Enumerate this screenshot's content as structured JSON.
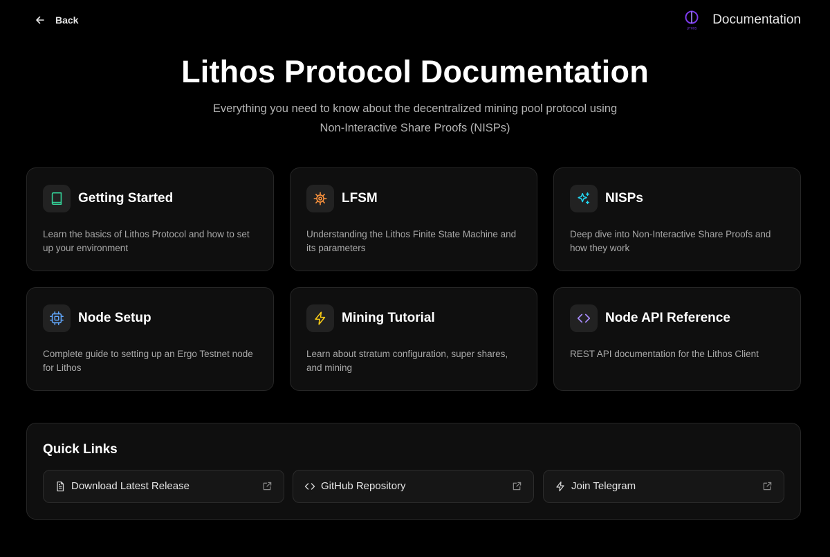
{
  "nav": {
    "back_label": "Back",
    "brand_logo_text": "LITHOS",
    "brand_title": "Documentation"
  },
  "hero": {
    "title": "Lithos Protocol Documentation",
    "subtitle_line1": "Everything you need to know about the decentralized mining pool protocol using",
    "subtitle_line2": "Non-Interactive Share Proofs (NISPs)"
  },
  "cards": [
    {
      "title": "Getting Started",
      "description": "Learn the basics of Lithos Protocol and how to set up your environment",
      "icon": "book-icon",
      "color": "#34d399"
    },
    {
      "title": "LFSM",
      "description": "Understanding the Lithos Finite State Machine and its parameters",
      "icon": "cog-icon",
      "color": "#fb923c"
    },
    {
      "title": "NISPs",
      "description": "Deep dive into Non-Interactive Share Proofs and how they work",
      "icon": "sparkles-icon",
      "color": "#22d3ee"
    },
    {
      "title": "Node Setup",
      "description": "Complete guide to setting up an Ergo Testnet node for Lithos",
      "icon": "cpu-icon",
      "color": "#60a5fa"
    },
    {
      "title": "Mining Tutorial",
      "description": "Learn about stratum configuration, super shares, and mining",
      "icon": "zap-icon",
      "color": "#facc15"
    },
    {
      "title": "Node API Reference",
      "description": "REST API documentation for the Lithos Client",
      "icon": "code-icon",
      "color": "#a78bfa"
    }
  ],
  "quick_links": {
    "title": "Quick Links",
    "items": [
      {
        "label": "Download Latest Release",
        "icon": "file-icon"
      },
      {
        "label": "GitHub Repository",
        "icon": "code-icon"
      },
      {
        "label": "Join Telegram",
        "icon": "zap-icon"
      }
    ]
  },
  "colors": {
    "background": "#000000",
    "card_background": "#0f0f0f",
    "card_border": "#262626",
    "brand_logo": "#7c3aed"
  }
}
